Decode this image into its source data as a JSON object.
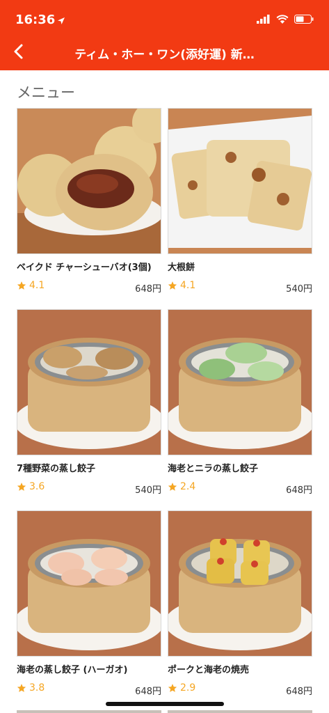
{
  "status": {
    "time": "16:36"
  },
  "header": {
    "title": "ティム・ホー・ワン(添好運) 新…"
  },
  "section": {
    "title": "メニュー"
  },
  "colors": {
    "accent": "#f23a13",
    "star": "#f5a623"
  },
  "items": [
    {
      "name": "ベイクド チャーシューバオ(3個)",
      "rating": "4.1",
      "price": "648円"
    },
    {
      "name": "大根餅",
      "rating": "4.1",
      "price": "540円"
    },
    {
      "name": "7種野菜の蒸し餃子",
      "rating": "3.6",
      "price": "540円"
    },
    {
      "name": "海老とニラの蒸し餃子",
      "rating": "2.4",
      "price": "648円"
    },
    {
      "name": "海老の蒸し餃子 (ハーガオ)",
      "rating": "3.8",
      "price": "648円"
    },
    {
      "name": "ポークと海老の焼売",
      "rating": "2.9",
      "price": "648円"
    }
  ]
}
